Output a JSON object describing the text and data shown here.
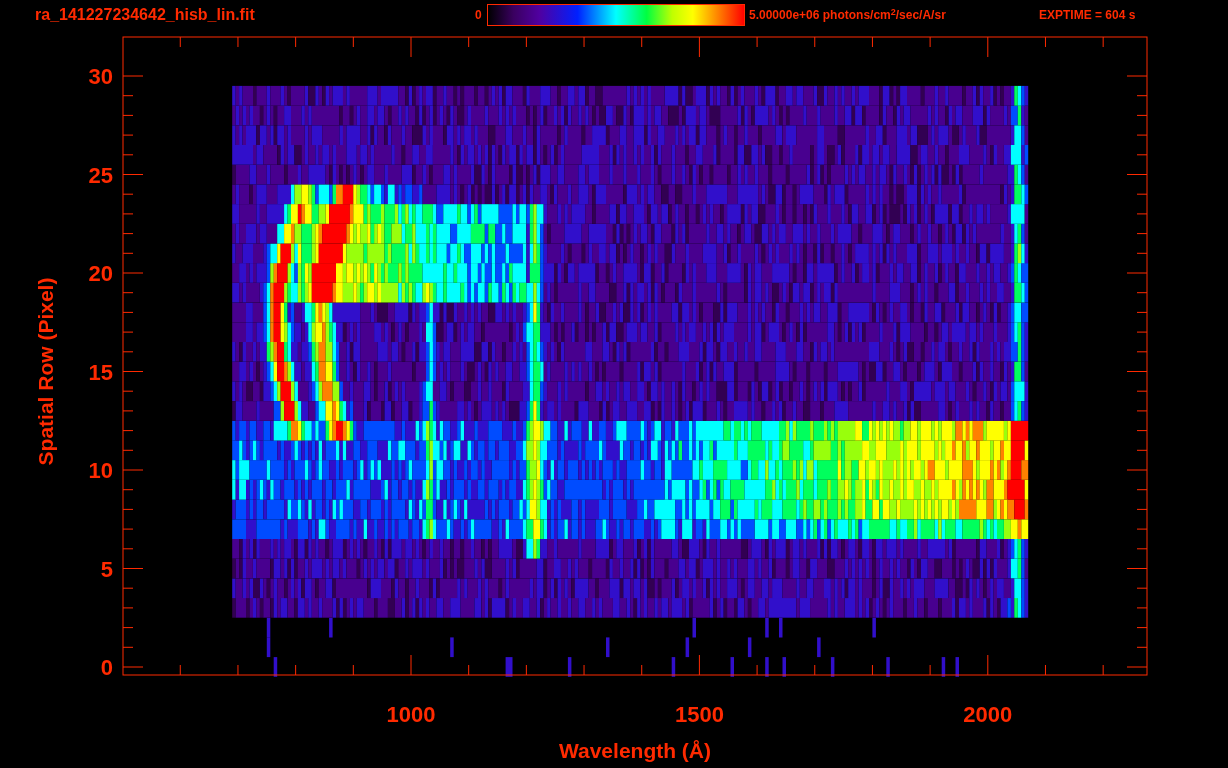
{
  "header": {
    "file_name": "ra_141227234642_hisb_lin.fit",
    "colorbar_min": "0",
    "colorbar_max": "5.00000e+06 photons/cm$^{2}$/sec/A/sr",
    "exposure": "EXPTIME = 604 s"
  },
  "plot": {
    "xlabel": "Wavelength (Å)",
    "ylabel": "Spatial Row (Pixel)",
    "xticks": [
      "1000",
      "1500",
      "2000"
    ],
    "yticks": [
      "30",
      "25",
      "20",
      "15",
      "10",
      "5",
      "0"
    ]
  }
}
